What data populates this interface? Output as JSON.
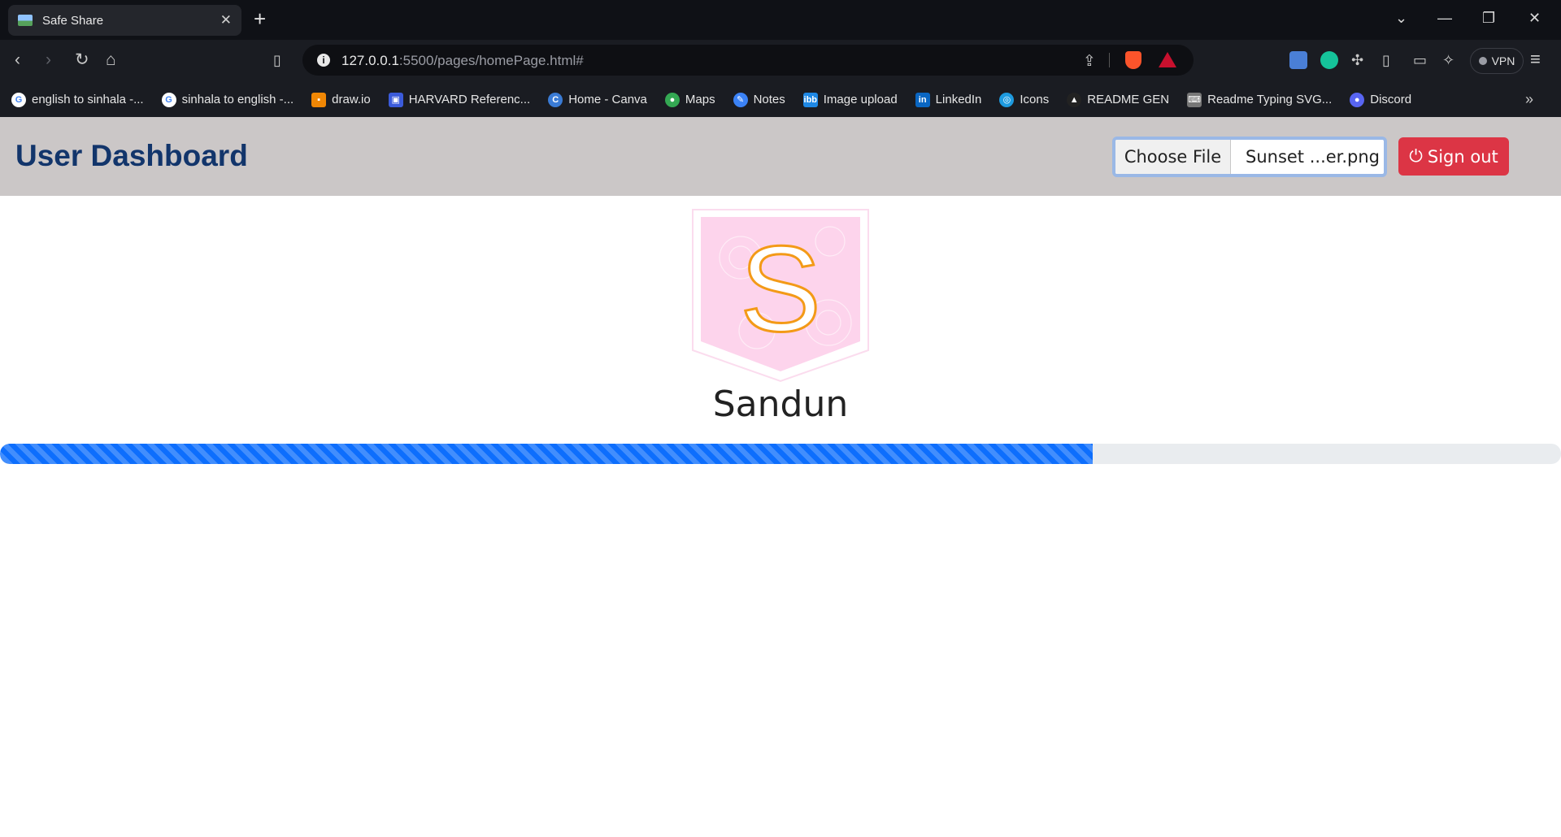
{
  "browser": {
    "tab_title": "Safe Share",
    "url_host": "127.0.0.1",
    "url_rest": ":5500/pages/homePage.html#",
    "vpn_label": "VPN",
    "bookmarks": [
      {
        "label": "english to sinhala -...",
        "icon": "google-icon",
        "color": "#ffffff"
      },
      {
        "label": "sinhala to english -...",
        "icon": "google-icon",
        "color": "#ffffff"
      },
      {
        "label": "draw.io",
        "icon": "drawio-icon",
        "color": "#f08705"
      },
      {
        "label": "HARVARD Referenc...",
        "icon": "harvard-icon",
        "color": "#3b5bdb"
      },
      {
        "label": "Home - Canva",
        "icon": "canva-icon",
        "color": "#3a7bd5"
      },
      {
        "label": "Maps",
        "icon": "maps-icon",
        "color": "#34a853"
      },
      {
        "label": "Notes",
        "icon": "notes-icon",
        "color": "#3b82f6"
      },
      {
        "label": "Image upload",
        "icon": "ibb-icon",
        "color": "#1e88e5"
      },
      {
        "label": "LinkedIn",
        "icon": "linkedin-icon",
        "color": "#0a66c2"
      },
      {
        "label": "Icons",
        "icon": "icons-icon",
        "color": "#1e9be0"
      },
      {
        "label": "README GEN",
        "icon": "readme-icon",
        "color": "#222222"
      },
      {
        "label": "Readme Typing SVG...",
        "icon": "keyboard-icon",
        "color": "#777777"
      },
      {
        "label": "Discord",
        "icon": "discord-icon",
        "color": "#5865f2"
      }
    ]
  },
  "header": {
    "title": "User Dashboard",
    "choose_file_label": "Choose File",
    "file_name": "Sunset ...er.png",
    "signout_label": "Sign out"
  },
  "profile": {
    "avatar_letter": "S",
    "username": "Sandun"
  },
  "upload": {
    "progress_percent": 70
  },
  "colors": {
    "header_bg": "#cbc7c7",
    "title": "#12356b",
    "signout": "#dc3545",
    "progress": "#0d6efd"
  }
}
